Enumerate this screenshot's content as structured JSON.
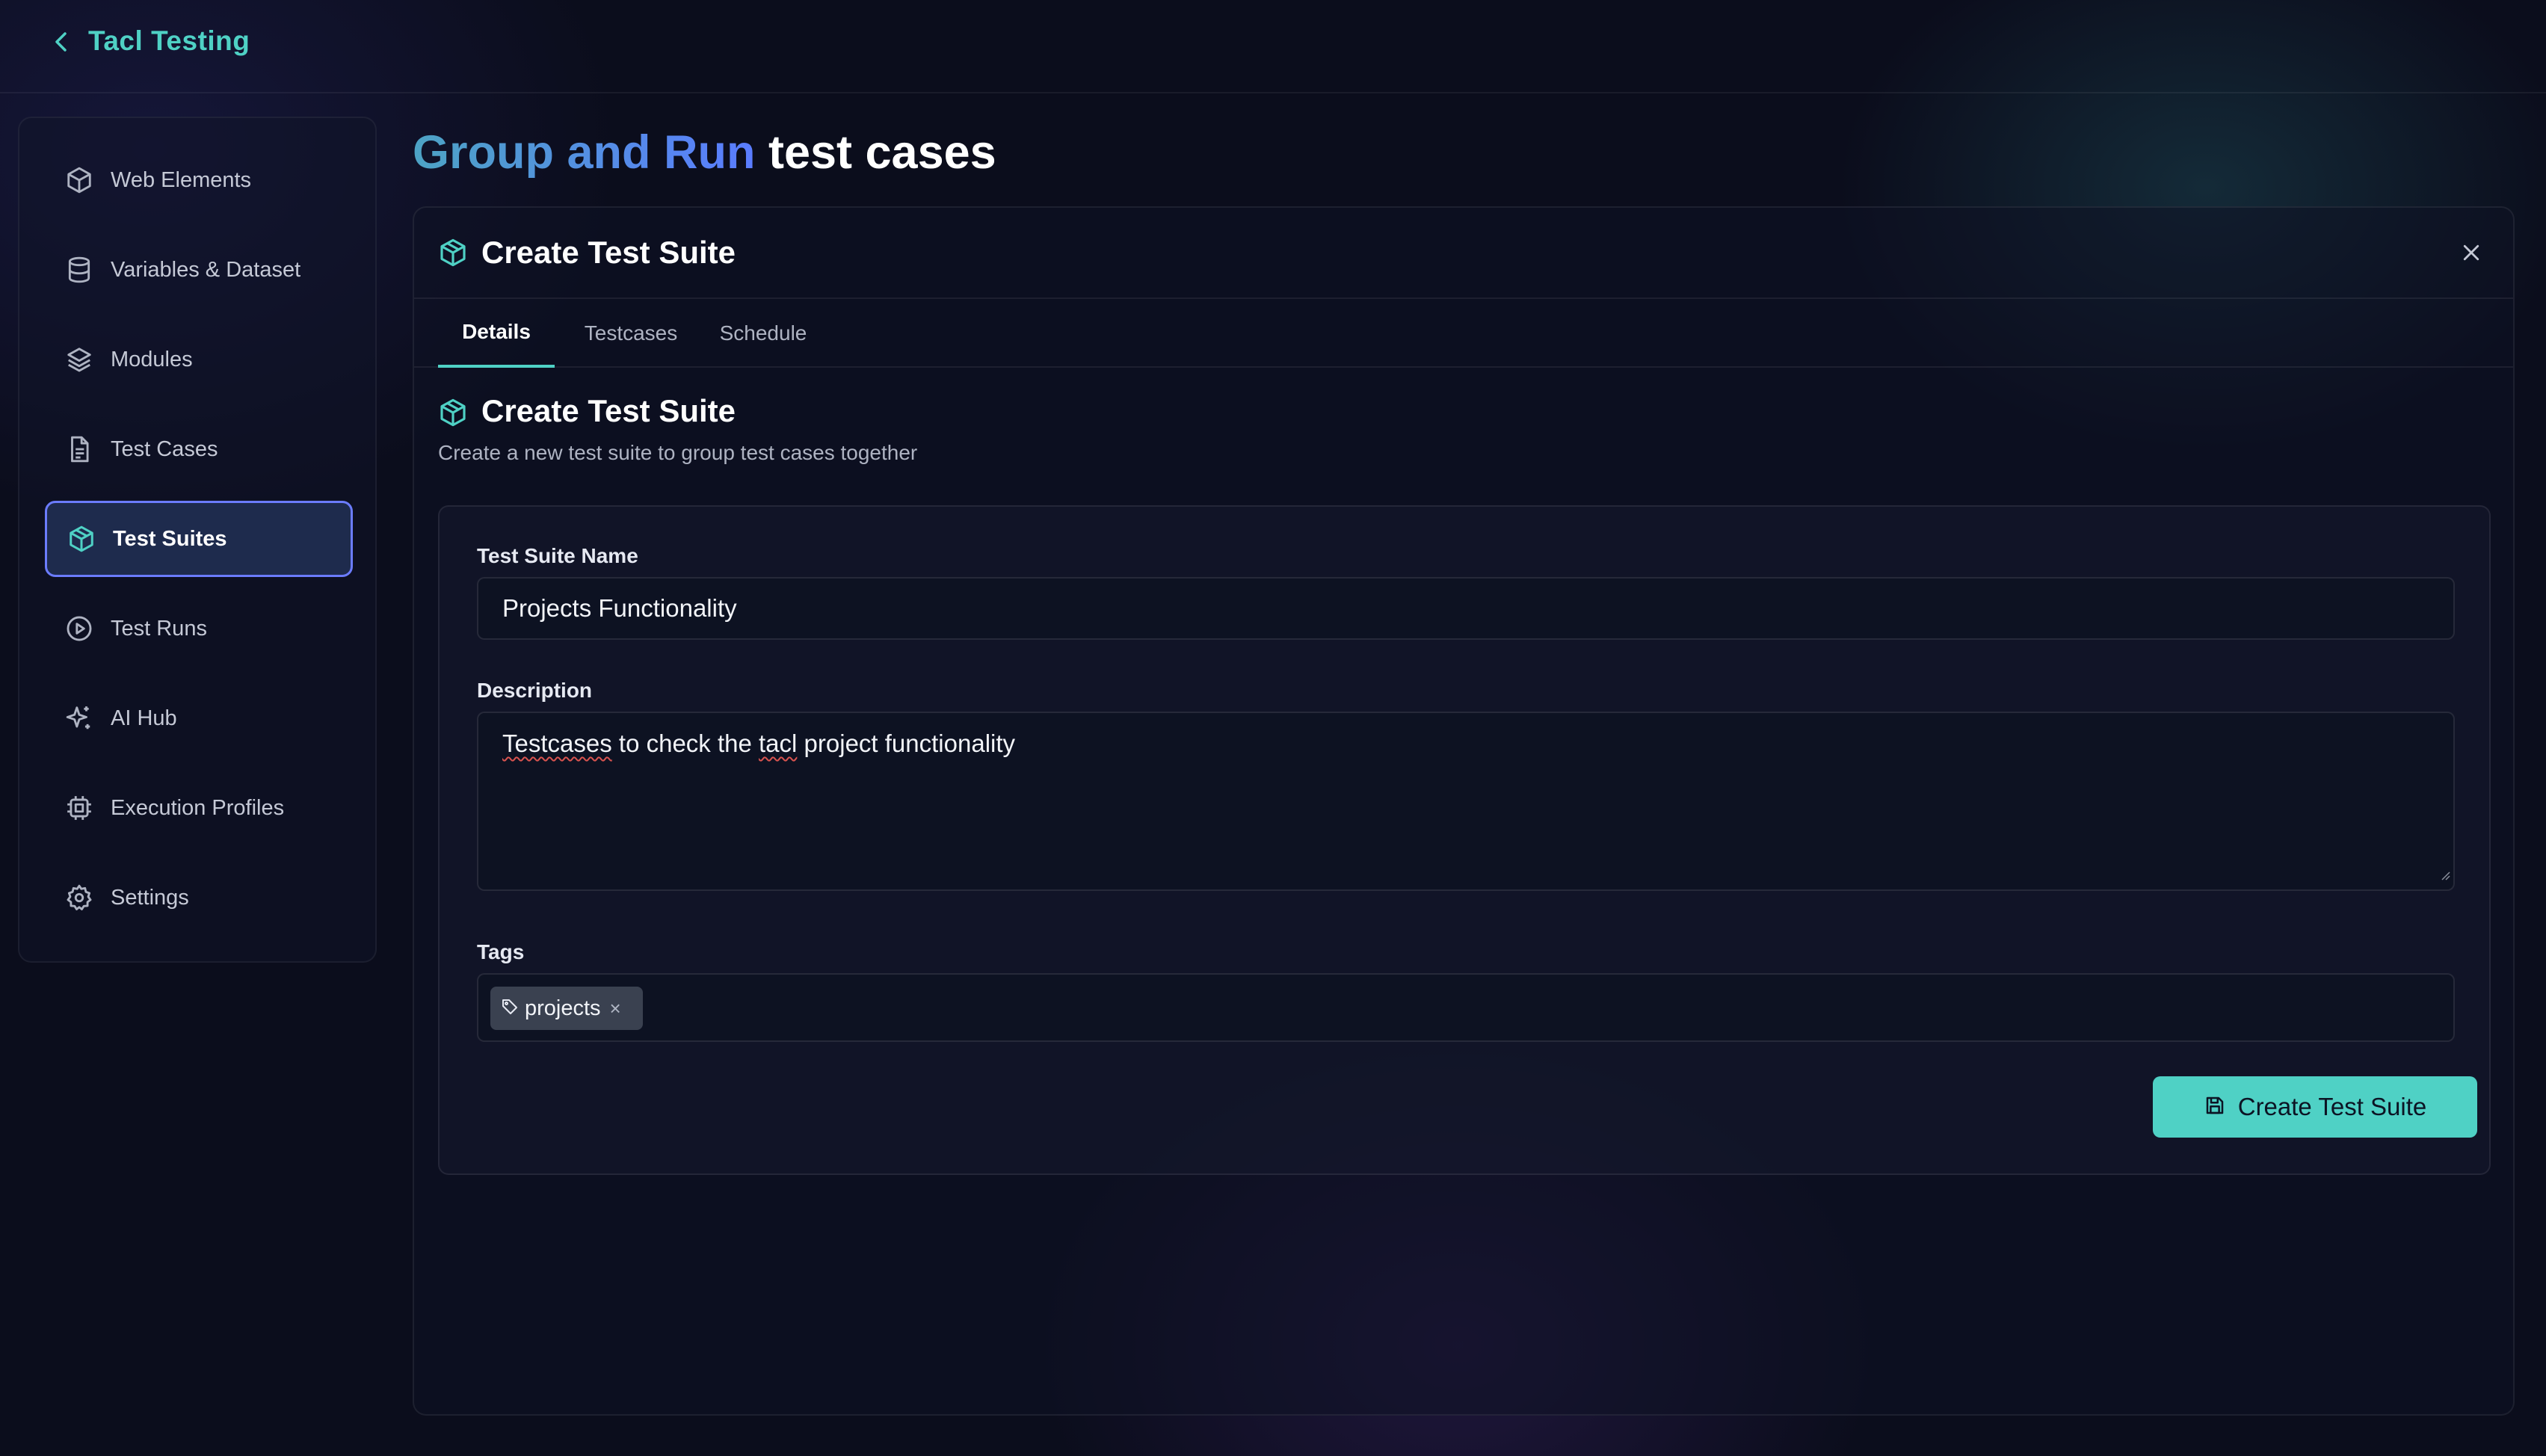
{
  "header": {
    "brand": "Tacl Testing"
  },
  "sidebar": {
    "items": [
      {
        "label": "Web Elements",
        "icon": "cube-icon"
      },
      {
        "label": "Variables & Dataset",
        "icon": "database-icon"
      },
      {
        "label": "Modules",
        "icon": "layers-icon"
      },
      {
        "label": "Test Cases",
        "icon": "file-icon"
      },
      {
        "label": "Test Suites",
        "icon": "package-icon",
        "active": true
      },
      {
        "label": "Test Runs",
        "icon": "play-circle-icon"
      },
      {
        "label": "AI Hub",
        "icon": "sparkles-icon"
      },
      {
        "label": "Execution Profiles",
        "icon": "cpu-icon"
      },
      {
        "label": "Settings",
        "icon": "gear-icon"
      }
    ]
  },
  "page": {
    "title_accent": "Group and Run",
    "title_rest": "test cases"
  },
  "panel": {
    "title": "Create Test Suite",
    "tabs": [
      {
        "label": "Details",
        "active": true
      },
      {
        "label": "Testcases"
      },
      {
        "label": "Schedule"
      }
    ],
    "section_title": "Create Test Suite",
    "section_subtitle": "Create a new test suite to group test cases together",
    "form": {
      "name_label": "Test Suite Name",
      "name_value": "Projects Functionality",
      "description_label": "Description",
      "description_value_parts": [
        "Testcases",
        " to check the ",
        "tacl",
        " project functionality"
      ],
      "tags_label": "Tags",
      "tags": [
        "projects"
      ],
      "tag_remove": "×",
      "submit_label": "Create Test Suite"
    }
  },
  "colors": {
    "accent_teal": "#4fd1c5",
    "accent_blue": "#5a7cff",
    "background": "#0b0d1c"
  }
}
